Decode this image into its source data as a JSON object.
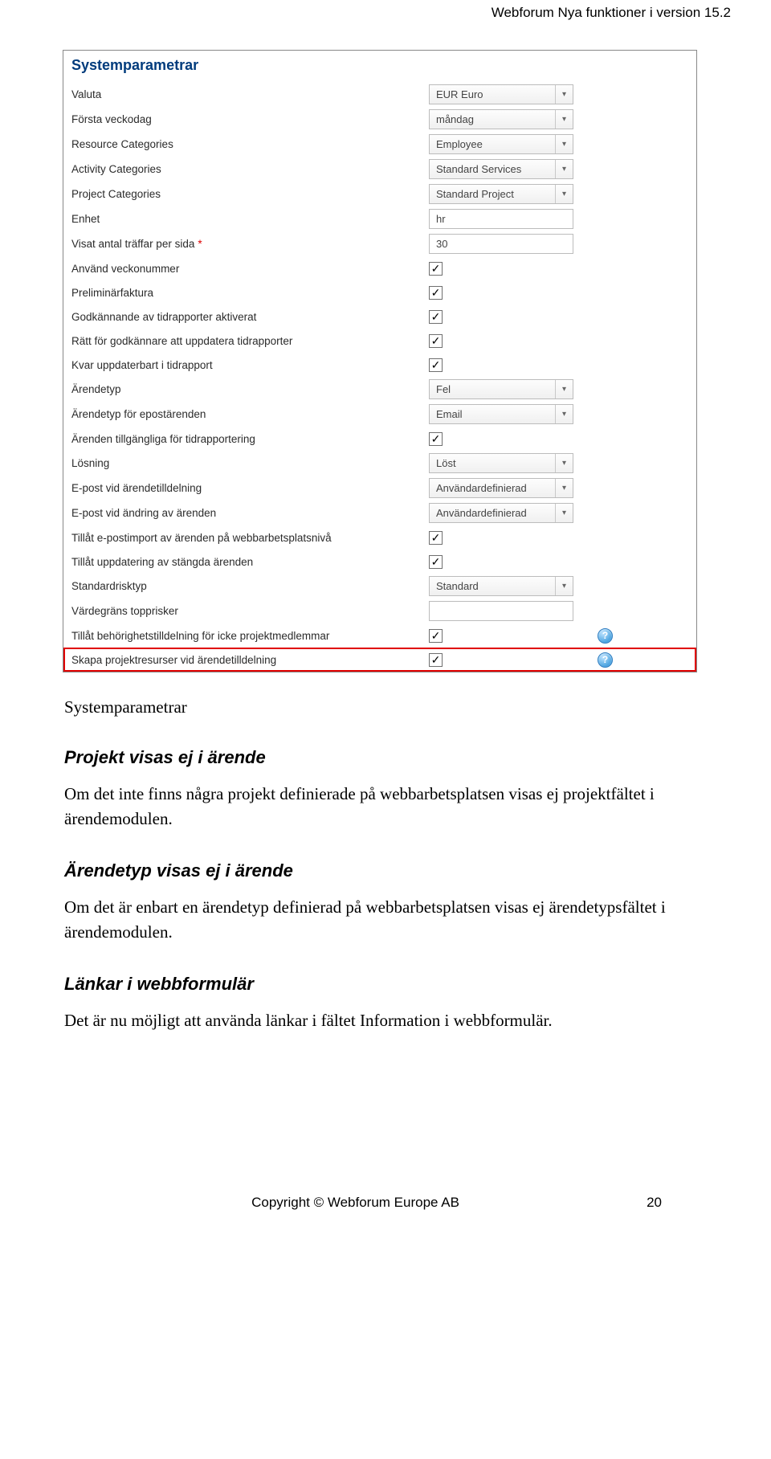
{
  "header_right": "Webforum Nya funktioner i version 15.2",
  "panel_title": "Systemparametrar",
  "rows": [
    {
      "label": "Valuta",
      "type": "select",
      "value": "EUR Euro"
    },
    {
      "label": "Första veckodag",
      "type": "select",
      "value": "måndag"
    },
    {
      "label": "Resource Categories",
      "type": "select",
      "value": "Employee"
    },
    {
      "label": "Activity Categories",
      "type": "select",
      "value": "Standard Services"
    },
    {
      "label": "Project Categories",
      "type": "select",
      "value": "Standard Project"
    },
    {
      "label": "Enhet",
      "type": "text",
      "value": "hr"
    },
    {
      "label": "Visat antal träffar per sida",
      "required": true,
      "type": "text",
      "value": "30"
    },
    {
      "label": "Använd veckonummer",
      "type": "check",
      "checked": true
    },
    {
      "label": "Preliminärfaktura",
      "type": "check",
      "checked": true
    },
    {
      "label": "Godkännande av tidrapporter aktiverat",
      "type": "check",
      "checked": true
    },
    {
      "label": "Rätt för godkännare att uppdatera tidrapporter",
      "type": "check",
      "checked": true
    },
    {
      "label": "Kvar uppdaterbart i tidrapport",
      "type": "check",
      "checked": true
    },
    {
      "label": "Ärendetyp",
      "type": "select",
      "value": "Fel"
    },
    {
      "label": "Ärendetyp för epostärenden",
      "type": "select",
      "value": "Email"
    },
    {
      "label": "Ärenden tillgängliga för tidrapportering",
      "type": "check",
      "checked": true
    },
    {
      "label": "Lösning",
      "type": "select",
      "value": "Löst"
    },
    {
      "label": "E-post vid ärendetilldelning",
      "type": "select",
      "value": "Användardefinierad"
    },
    {
      "label": "E-post vid ändring av ärenden",
      "type": "select",
      "value": "Användardefinierad"
    },
    {
      "label": "Tillåt e-postimport av ärenden på webbarbetsplatsnivå",
      "type": "check",
      "checked": true
    },
    {
      "label": "Tillåt uppdatering av stängda ärenden",
      "type": "check",
      "checked": true
    },
    {
      "label": "Standardrisktyp",
      "type": "select",
      "value": "Standard"
    },
    {
      "label": "Värdegräns topprisker",
      "type": "text",
      "value": ""
    },
    {
      "label": "Tillåt behörighetstilldelning för icke projektmedlemmar",
      "type": "check",
      "checked": true,
      "help": true
    },
    {
      "label": "Skapa projektresurser vid ärendetilldelning",
      "type": "check",
      "checked": true,
      "help": true,
      "highlight": true
    }
  ],
  "caption": "Systemparametrar",
  "section1_title": "Projekt visas ej i ärende",
  "section1_para": "Om det inte finns några projekt definierade på webbarbetsplatsen visas ej projektfältet i ärendemodulen.",
  "section2_title": "Ärendetyp visas ej i ärende",
  "section2_para": "Om det är enbart en ärendetyp definierad på webbarbetsplatsen visas ej ärendetypsfältet i ärendemodulen.",
  "section3_title": "Länkar i webbformulär",
  "section3_para": "Det är nu möjligt att använda länkar i fältet Information i webbformulär.",
  "footer_center": "Copyright © Webforum Europe AB",
  "footer_page": "20",
  "checkmark": "✓",
  "chevron": "▾"
}
